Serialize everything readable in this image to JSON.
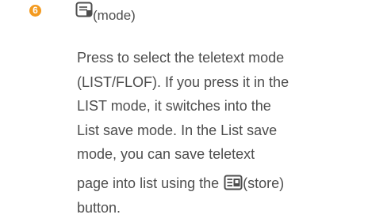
{
  "item": {
    "number": "6",
    "mode_label": "(mode)",
    "lines": [
      "Press to select the teletext mode",
      "(LIST/FLOF). If you press it in the",
      "LIST mode, it switches into the",
      "List save mode. In the List save",
      "mode, you can save teletext"
    ],
    "store_line_prefix": "page into list using the",
    "store_label": "(store)",
    "last_line": "button."
  },
  "icons": {
    "badge_color": "#f39a1f",
    "mode_icon": "teletext-mode-icon",
    "store_icon": "teletext-store-icon"
  }
}
